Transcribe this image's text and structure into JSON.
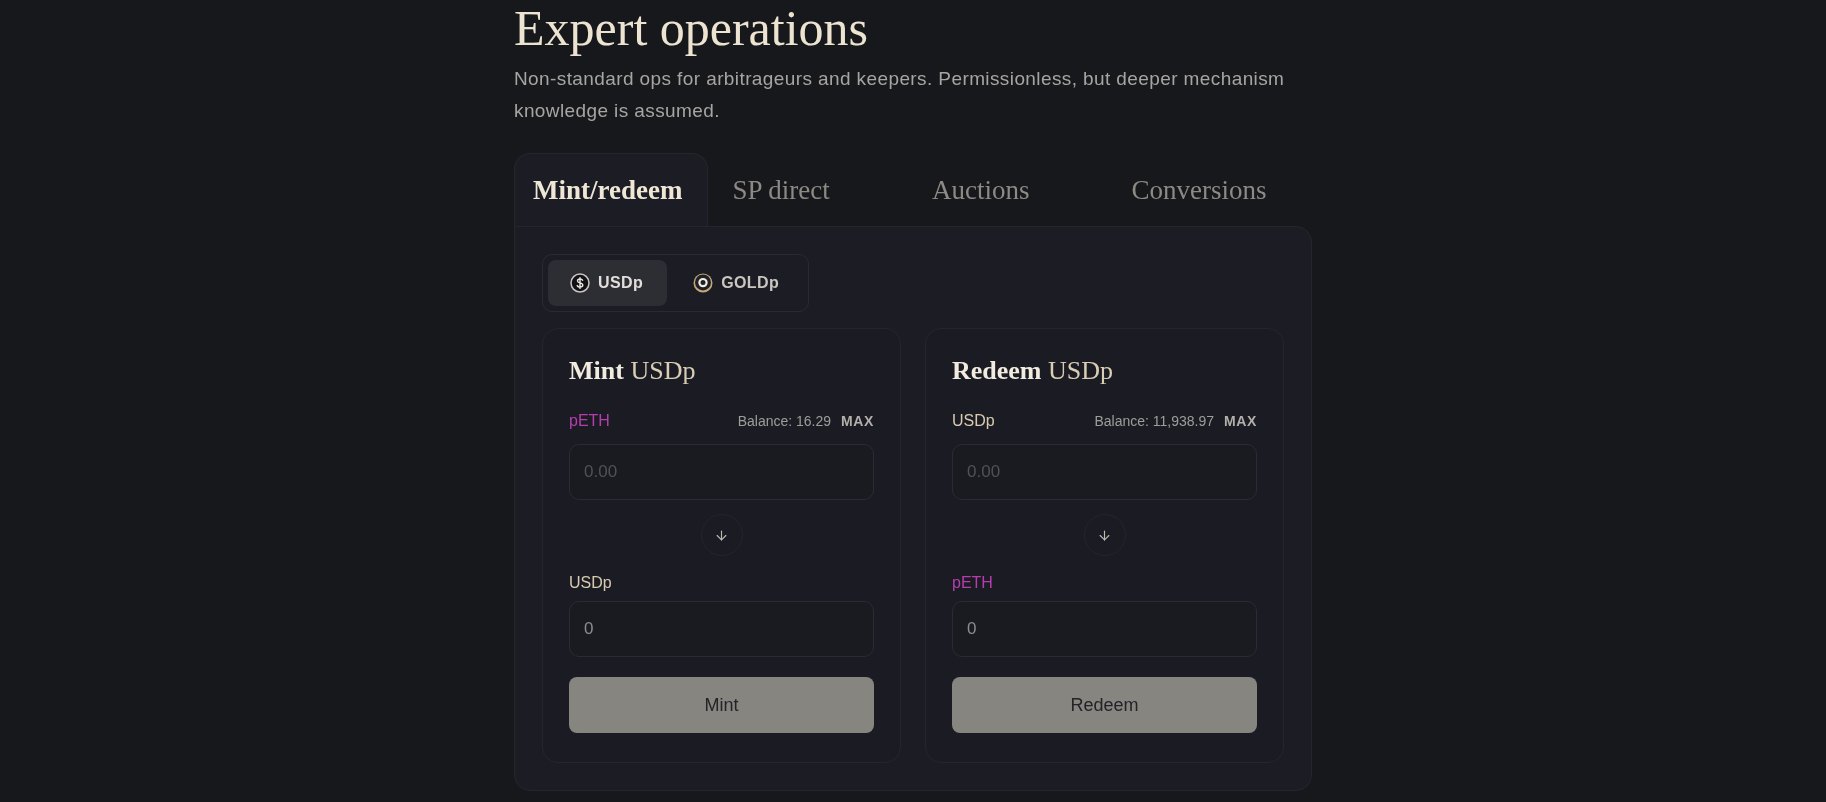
{
  "header": {
    "title": "Expert operations",
    "subtitle": "Non-standard ops for arbitrageurs and keepers. Permissionless, but deeper mechanism knowledge is assumed."
  },
  "tabs": [
    {
      "label": "Mint/redeem",
      "selected": true
    },
    {
      "label": "SP direct",
      "selected": false
    },
    {
      "label": "Auctions",
      "selected": false
    },
    {
      "label": "Conversions",
      "selected": false
    }
  ],
  "assets": [
    {
      "label": "USDp",
      "selected": true
    },
    {
      "label": "GOLDp",
      "selected": false
    }
  ],
  "forms": [
    {
      "title": "**Mint** USDp",
      "fields": [
        {
          "token": "pETH",
          "color": "#b53daf",
          "balance": "Balance: 16.29",
          "max": "MAX",
          "placeholder": "0.00"
        },
        {
          "token": "USDp",
          "color": "#d8cbb0",
          "value": "0"
        }
      ],
      "button": "Mint"
    },
    {
      "title": "**Redeem** USDp",
      "fields": [
        {
          "token": "USDp",
          "color": "#d8cbb0",
          "balance": "Balance: 11,938.97",
          "max": "MAX",
          "placeholder": "0.00"
        },
        {
          "token": "pETH",
          "color": "#b53daf",
          "value": "0"
        }
      ],
      "button": "Redeem"
    }
  ]
}
